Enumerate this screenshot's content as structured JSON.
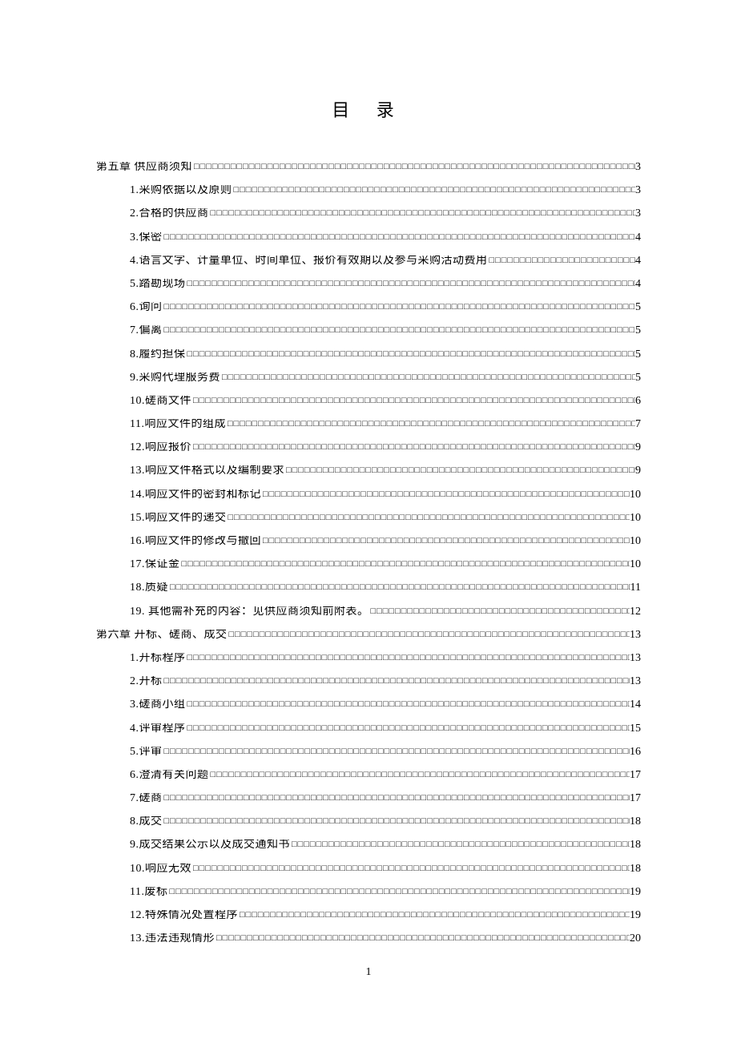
{
  "title": "目 录",
  "page_number": "1",
  "toc": [
    {
      "level": 0,
      "label": "第五章  供应商须知",
      "page": "3"
    },
    {
      "level": 1,
      "label": "1.采购依据以及原则",
      "page": "3"
    },
    {
      "level": 1,
      "label": "2.合格的供应商",
      "page": "3"
    },
    {
      "level": 1,
      "label": "3.保密",
      "page": "4"
    },
    {
      "level": 1,
      "label": "4.语言文字、计量单位、时间单位、报价有效期以及参与采购活动费用",
      "page": "4"
    },
    {
      "level": 1,
      "label": "5.踏勘现场",
      "page": "4"
    },
    {
      "level": 1,
      "label": "6.询问",
      "page": "5"
    },
    {
      "level": 1,
      "label": "7.偏离",
      "page": "5"
    },
    {
      "level": 1,
      "label": "8.履约担保",
      "page": "5"
    },
    {
      "level": 1,
      "label": "9.采购代理服务费",
      "page": "5"
    },
    {
      "level": 1,
      "label": "10.磋商文件",
      "page": "6"
    },
    {
      "level": 1,
      "label": "11.响应文件的组成",
      "page": "7"
    },
    {
      "level": 1,
      "label": "12.响应报价",
      "page": "9"
    },
    {
      "level": 1,
      "label": "13.响应文件格式以及编制要求",
      "page": "9"
    },
    {
      "level": 1,
      "label": "14.响应文件的密封和标记",
      "page": "10"
    },
    {
      "level": 1,
      "label": "15.响应文件的递交",
      "page": "10"
    },
    {
      "level": 1,
      "label": "16.响应文件的修改与撤回",
      "page": "10"
    },
    {
      "level": 1,
      "label": "17.保证金",
      "page": "10"
    },
    {
      "level": 1,
      "label": "18.质疑",
      "page": "11"
    },
    {
      "level": 1,
      "label": "19. 其他需补充的内容：见供应商须知前附表。",
      "page": "12"
    },
    {
      "level": 0,
      "label": "第六章  开标、磋商、成交",
      "page": "13"
    },
    {
      "level": 1,
      "label": "1.开标程序",
      "page": "13"
    },
    {
      "level": 1,
      "label": "2.开标",
      "page": "13"
    },
    {
      "level": 1,
      "label": "3.磋商小组",
      "page": "14"
    },
    {
      "level": 1,
      "label": "4.评审程序",
      "page": "15"
    },
    {
      "level": 1,
      "label": "5.评审",
      "page": "16"
    },
    {
      "level": 1,
      "label": "6.澄清有关问题",
      "page": "17"
    },
    {
      "level": 1,
      "label": "7.磋商",
      "page": "17"
    },
    {
      "level": 1,
      "label": "8.成交",
      "page": "18"
    },
    {
      "level": 1,
      "label": "9.成交结果公示以及成交通知书",
      "page": "18"
    },
    {
      "level": 1,
      "label": "10.响应无效",
      "page": "18"
    },
    {
      "level": 1,
      "label": "11.废标",
      "page": "19"
    },
    {
      "level": 1,
      "label": "12.特殊情况处置程序",
      "page": "19"
    },
    {
      "level": 1,
      "label": "13.违法违规情形",
      "page": "20"
    }
  ]
}
